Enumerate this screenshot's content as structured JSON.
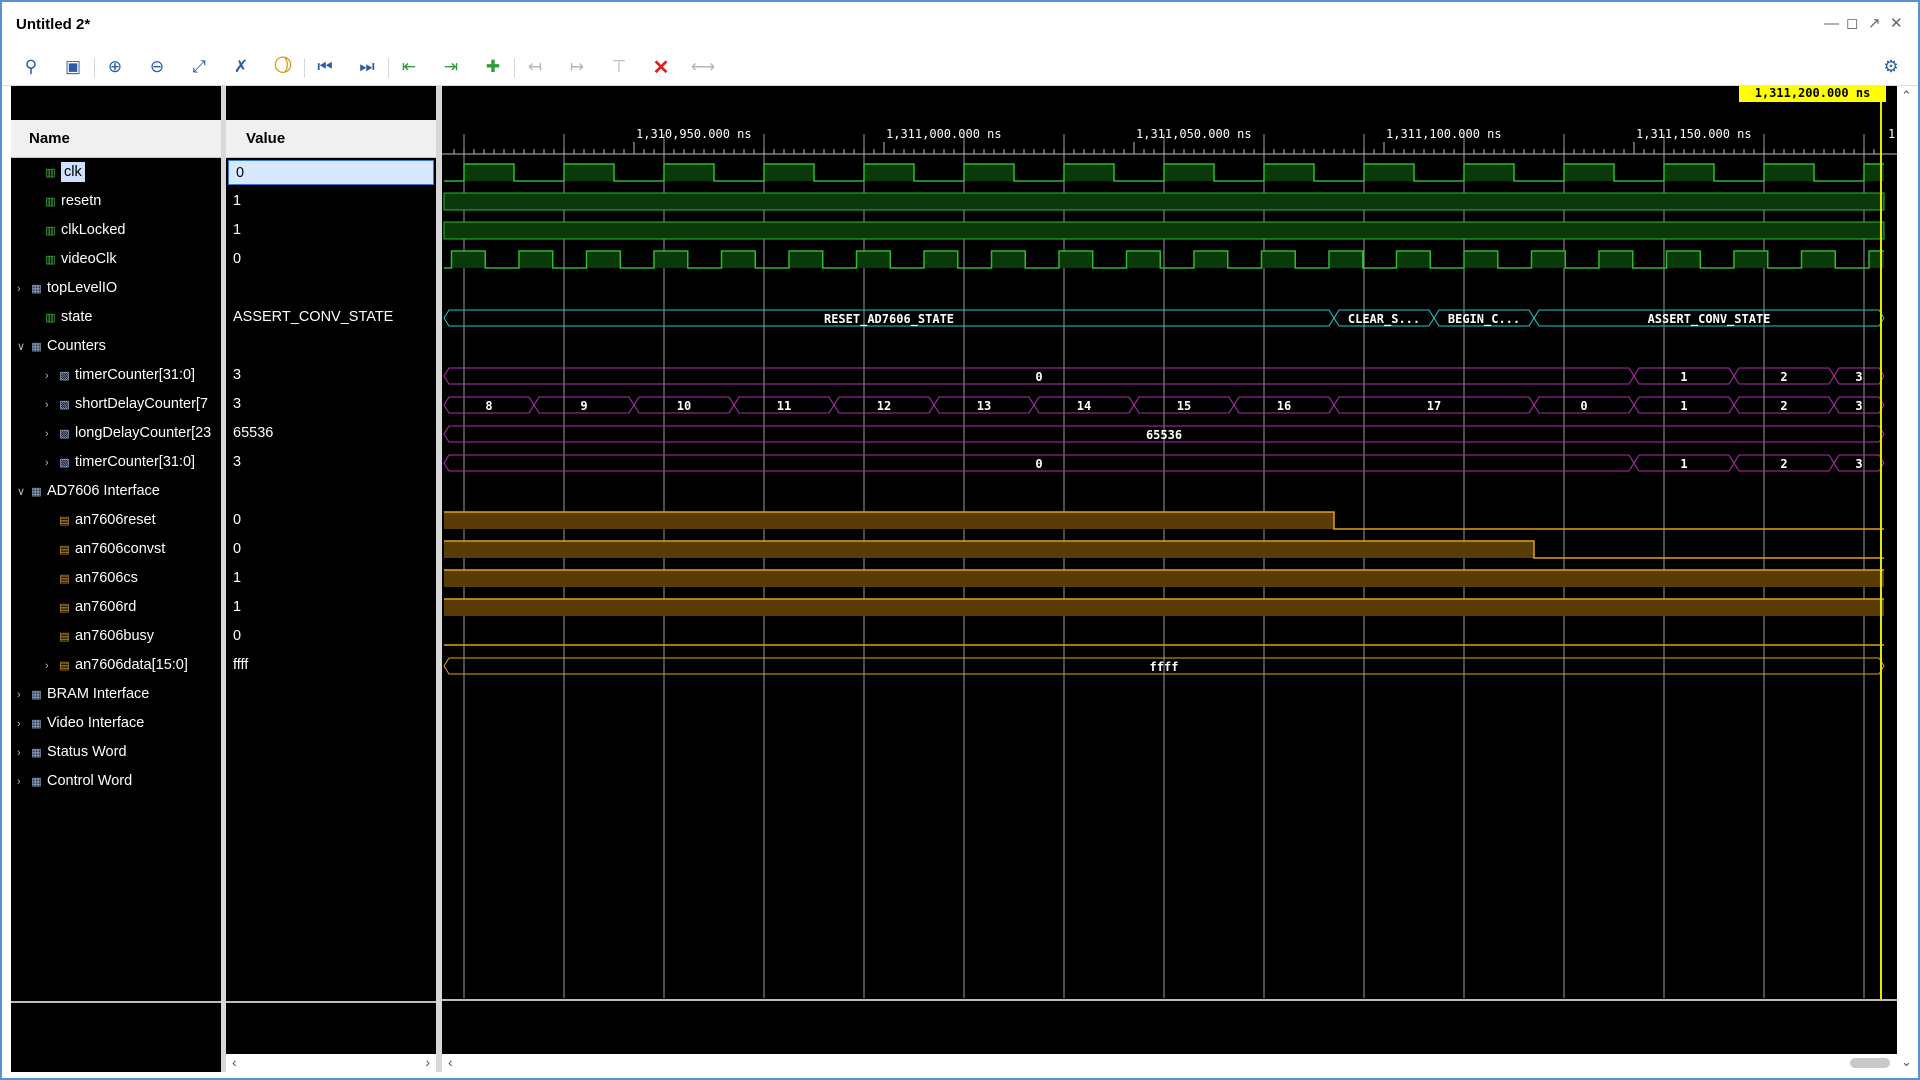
{
  "window": {
    "title": "Untitled 2*",
    "controls": [
      "minimize-icon",
      "maximize-icon",
      "restore-icon",
      "close-icon"
    ]
  },
  "toolbar": {
    "buttons": [
      {
        "name": "search-button",
        "icon": "search-icon"
      },
      {
        "name": "save-button",
        "icon": "save-icon"
      },
      {
        "name": "zoom-in-button",
        "icon": "zoom-in-icon"
      },
      {
        "name": "zoom-out-button",
        "icon": "zoom-out-icon"
      },
      {
        "name": "zoom-fit-button",
        "icon": "zoom-fit-icon"
      },
      {
        "name": "swap-cursor-button",
        "icon": "swap-cursor-icon"
      },
      {
        "name": "snap-cursor-button",
        "icon": "snap-cursor-icon"
      },
      {
        "name": "go-to-start-button",
        "icon": "go-to-start-icon"
      },
      {
        "name": "go-to-end-button",
        "icon": "go-to-end-icon"
      },
      {
        "name": "previous-transition-button",
        "icon": "previous-transition-icon"
      },
      {
        "name": "next-transition-button",
        "icon": "next-transition-icon"
      },
      {
        "name": "add-marker-button",
        "icon": "add-marker-icon"
      },
      {
        "name": "previous-marker-button",
        "icon": "previous-marker-icon"
      },
      {
        "name": "next-marker-button",
        "icon": "next-marker-icon"
      },
      {
        "name": "delete-marker-button",
        "icon": "delete-marker-icon"
      },
      {
        "name": "delete-all-markers-button",
        "icon": "delete-all-markers-icon"
      },
      {
        "name": "fit-range-button",
        "icon": "fit-range-icon"
      }
    ],
    "settings_icon": "gear-icon"
  },
  "columns": {
    "name": "Name",
    "value": "Value"
  },
  "signals": [
    {
      "indent": 1,
      "expander": "",
      "icon": "signal",
      "name": "clk",
      "value": "0",
      "selected": true
    },
    {
      "indent": 1,
      "expander": "",
      "icon": "signal",
      "name": "resetn",
      "value": "1"
    },
    {
      "indent": 1,
      "expander": "",
      "icon": "signal",
      "name": "clkLocked",
      "value": "1"
    },
    {
      "indent": 1,
      "expander": "",
      "icon": "signal",
      "name": "videoClk",
      "value": "0"
    },
    {
      "indent": 0,
      "expander": ">",
      "icon": "group",
      "name": "topLevelIO",
      "value": ""
    },
    {
      "indent": 1,
      "expander": "",
      "icon": "signal",
      "name": "state",
      "value": "ASSERT_CONV_STATE"
    },
    {
      "indent": 0,
      "expander": "v",
      "icon": "group",
      "name": "Counters",
      "value": ""
    },
    {
      "indent": 2,
      "expander": ">",
      "icon": "vector",
      "name": "timerCounter[31:0]",
      "value": "3"
    },
    {
      "indent": 2,
      "expander": ">",
      "icon": "vector",
      "name": "shortDelayCounter[7",
      "value": "3"
    },
    {
      "indent": 2,
      "expander": ">",
      "icon": "vector",
      "name": "longDelayCounter[23",
      "value": "65536"
    },
    {
      "indent": 2,
      "expander": ">",
      "icon": "vector",
      "name": "timerCounter[31:0]",
      "value": "3"
    },
    {
      "indent": 0,
      "expander": "v",
      "icon": "group",
      "name": "AD7606 Interface",
      "value": ""
    },
    {
      "indent": 2,
      "expander": "",
      "icon": "bus",
      "name": "an7606reset",
      "value": "0"
    },
    {
      "indent": 2,
      "expander": "",
      "icon": "bus",
      "name": "an7606convst",
      "value": "0"
    },
    {
      "indent": 2,
      "expander": "",
      "icon": "bus",
      "name": "an7606cs",
      "value": "1"
    },
    {
      "indent": 2,
      "expander": "",
      "icon": "bus",
      "name": "an7606rd",
      "value": "1"
    },
    {
      "indent": 2,
      "expander": "",
      "icon": "bus",
      "name": "an7606busy",
      "value": "0"
    },
    {
      "indent": 2,
      "expander": ">",
      "icon": "bus",
      "name": "an7606data[15:0]",
      "value": "ffff"
    },
    {
      "indent": 0,
      "expander": ">",
      "icon": "group",
      "name": "BRAM Interface",
      "value": ""
    },
    {
      "indent": 0,
      "expander": ">",
      "icon": "group",
      "name": "Video Interface",
      "value": ""
    },
    {
      "indent": 0,
      "expander": ">",
      "icon": "group",
      "name": "Status Word",
      "value": ""
    },
    {
      "indent": 0,
      "expander": ">",
      "icon": "group",
      "name": "Control Word",
      "value": ""
    }
  ],
  "timeline": {
    "cursor_label": "1,311,200.000 ns",
    "ticks": [
      "1,310,950.000 ns",
      "1,311,000.000 ns",
      "1,311,050.000 ns",
      "1,311,100.000 ns",
      "1,311,150.000 ns"
    ],
    "truncated_tick": "1"
  },
  "wave_labels": {
    "state": [
      "RESET_AD7606_STATE",
      "CLEAR_S...",
      "BEGIN_C...",
      "ASSERT_CONV_STATE"
    ],
    "timerCounter": [
      "0",
      "1",
      "2",
      "3"
    ],
    "shortDelayCounter": [
      "8",
      "9",
      "10",
      "11",
      "12",
      "13",
      "14",
      "15",
      "16",
      "17",
      "0",
      "1",
      "2",
      "3"
    ],
    "longDelayCounter": [
      "65536"
    ],
    "timerCounter2": [
      "0",
      "1",
      "2",
      "3"
    ],
    "an7606data": [
      "ffff"
    ]
  },
  "colors": {
    "clock": "#2db82d",
    "clock_fill": "#0a3a0a",
    "state": "#1fc8c8",
    "counter": "#b030b0",
    "bus": "#e0a020",
    "bus_fill": "#5a3d05",
    "grid": "#9a9a9a",
    "cursor": "#e8e800"
  }
}
